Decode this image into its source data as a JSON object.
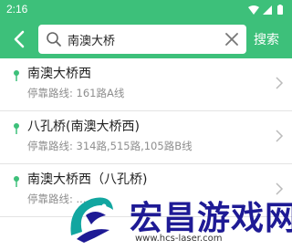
{
  "status": {
    "time": "2:16"
  },
  "search": {
    "query": "南澳大桥",
    "button_label": "搜索"
  },
  "results": [
    {
      "name": "南澳大桥西",
      "routes": "停靠路线: 161路A线"
    },
    {
      "name": "八孔桥(南澳大桥西)",
      "routes": "停靠路线: 314路,515路,105路B线"
    },
    {
      "name": "南澳大桥西（八孔桥)",
      "routes": "停靠路线: ..."
    }
  ],
  "watermark": {
    "title": "宏昌游戏网",
    "url": "www.hcs-laser.com"
  },
  "colors": {
    "brand_green": "#3dc07a",
    "watermark_blue": "#1e1a95"
  }
}
